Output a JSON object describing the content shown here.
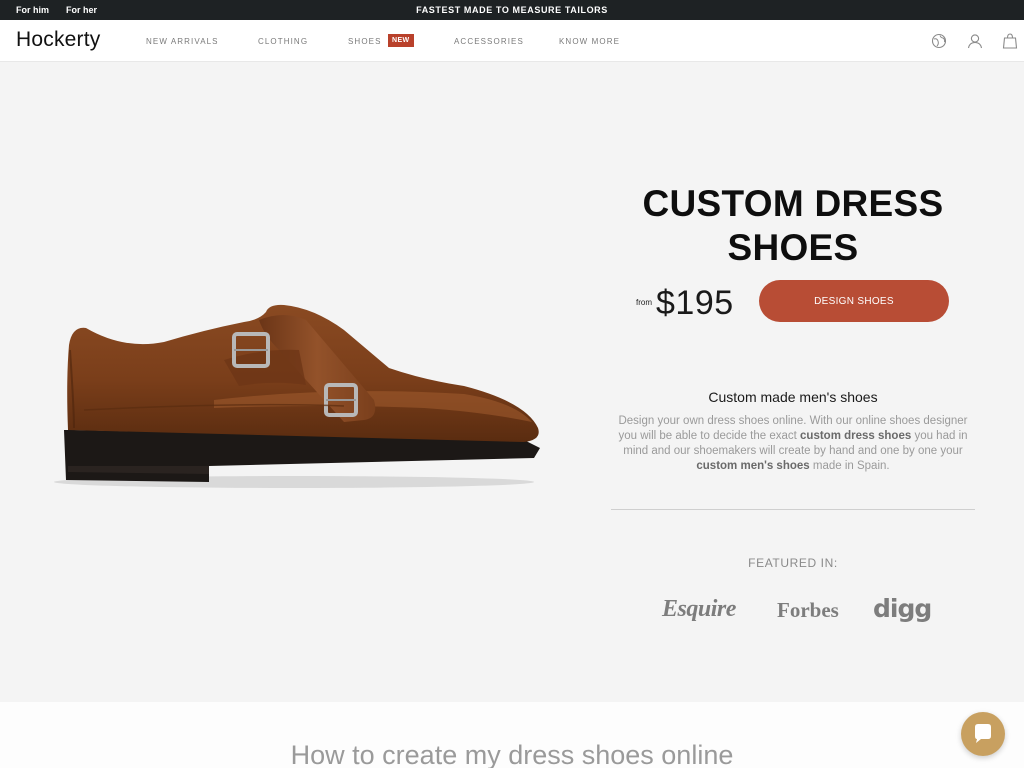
{
  "topbar": {
    "for_him": "For him",
    "for_her": "For her",
    "promo": "FASTEST MADE TO MEASURE TAILORS"
  },
  "header": {
    "logo": "Hockerty",
    "nav": [
      "NEW ARRIVALS",
      "CLOTHING",
      "SHOES",
      "ACCESSORIES",
      "KNOW MORE"
    ],
    "badge": "NEW",
    "icons": [
      "globe-icon",
      "user-icon",
      "bag-icon"
    ]
  },
  "hero": {
    "title_line1": "CUSTOM DRESS",
    "title_line2": "SHOES",
    "from_label": "from",
    "price": "$195",
    "cta": "DESIGN SHOES",
    "subtitle": "Custom made men's shoes",
    "desc_1": "Design your own dress shoes online. With our online shoes designer you will be able to decide the exact ",
    "desc_b1": "custom dress shoes",
    "desc_2": " you had in mind and our shoemakers will create by hand and one by one your ",
    "desc_b2": "custom men's shoes",
    "desc_3": " made in Spain.",
    "featured": "FEATURED IN:",
    "press": [
      "Esquire",
      "Forbes",
      "digg"
    ]
  },
  "lower": {
    "title": "How to create my dress shoes online"
  },
  "colors": {
    "accent": "#b84d35",
    "topbar": "#1e2224",
    "chat": "#c8a060"
  }
}
